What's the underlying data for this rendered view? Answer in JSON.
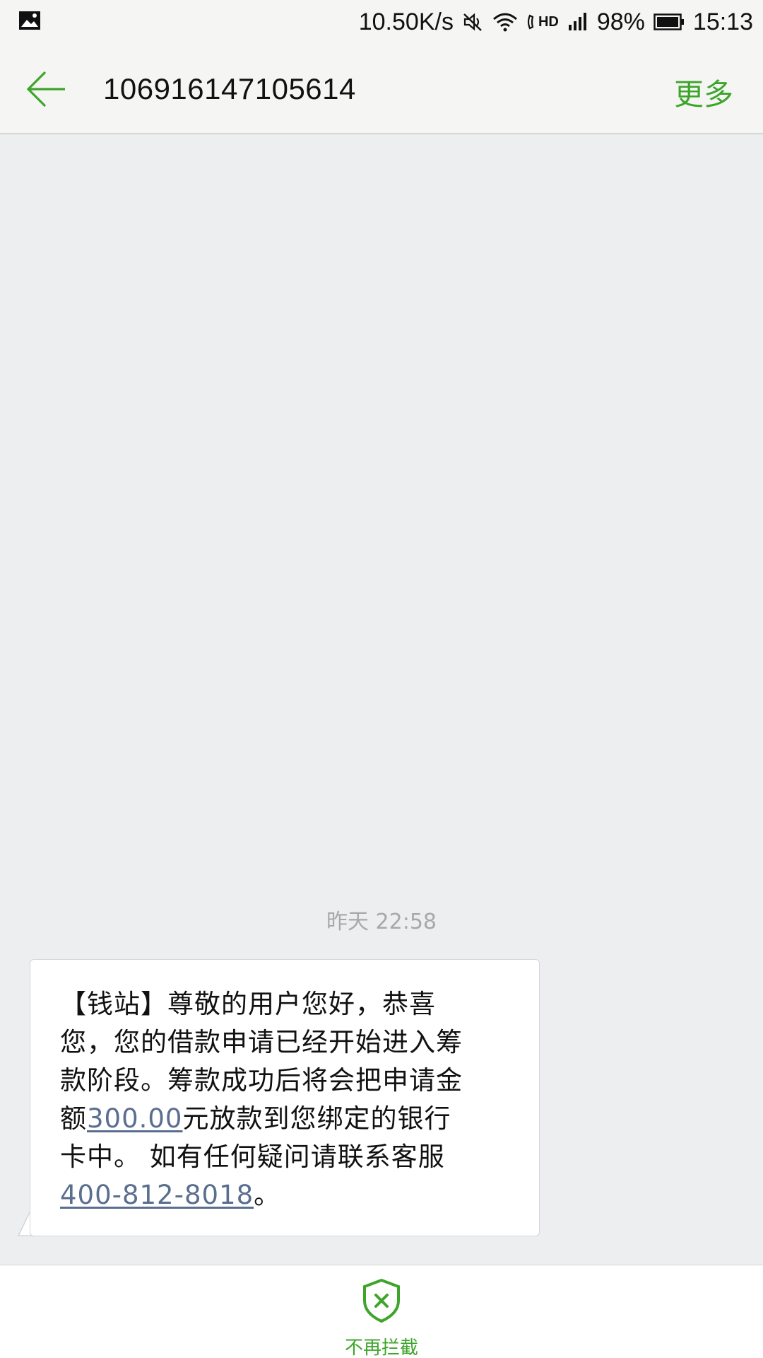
{
  "status_bar": {
    "speed": "10.50K/s",
    "hd": "HD",
    "battery": "98%",
    "time": "15:13",
    "icons": [
      "gallery-icon",
      "mute-icon",
      "wifi-icon",
      "hd-call-icon",
      "signal-icon",
      "battery-icon"
    ]
  },
  "header": {
    "sender": "106916147105614",
    "more_label": "更多",
    "back_icon": "back-arrow-icon",
    "accent_color": "#3ea52a"
  },
  "conversation": {
    "timestamp": "昨天 22:58",
    "message": {
      "part1": "【钱站】尊敬的用户您好，恭喜您，您的借款申请已经开始进入筹款阶段。筹款成功后将会把申请金额",
      "amount": "300.00",
      "part2": "元放款到您绑定的银行卡中。 如有任何疑问请联系客服",
      "phone": "400-812-8018",
      "part3": "。"
    }
  },
  "bottom_bar": {
    "unblock_label": "不再拦截",
    "unblock_icon": "shield-x-icon"
  }
}
